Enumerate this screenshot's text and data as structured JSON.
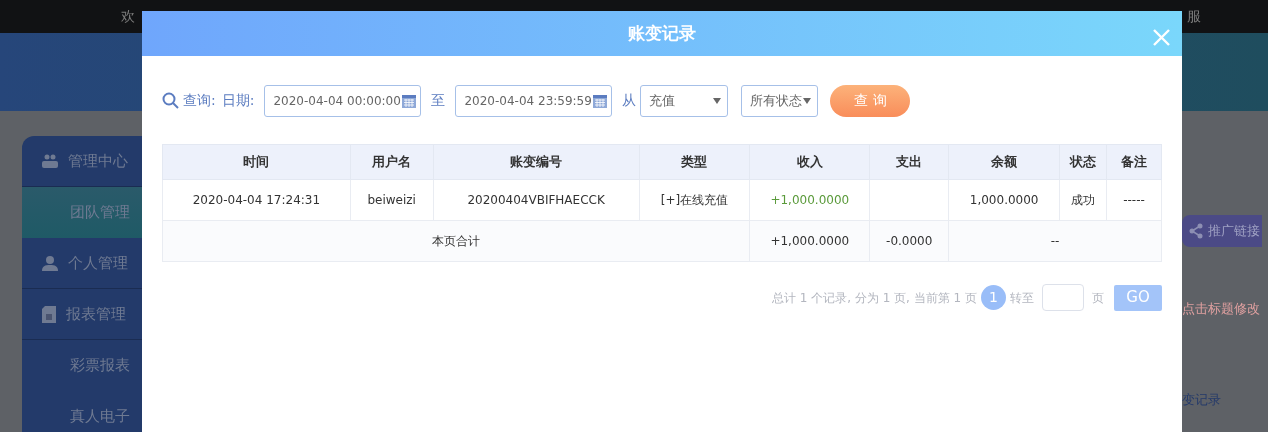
{
  "background": {
    "top_bar": {
      "welcome": "欢",
      "service": "服"
    },
    "sidebar": {
      "items": [
        {
          "label": "管理中心",
          "children": [
            {
              "label": "团队管理",
              "selected": true
            }
          ]
        },
        {
          "label": "个人管理"
        },
        {
          "label": "报表管理",
          "children": [
            {
              "label": "彩票报表",
              "selected": false
            },
            {
              "label": "真人电子",
              "selected": false
            }
          ]
        }
      ]
    },
    "right_panel": {
      "promo_button": "推广链接",
      "hint": "点击标题修改",
      "link": "变记录"
    }
  },
  "modal": {
    "title": "账变记录",
    "filters": {
      "search_label": "查询:",
      "date_label": "日期:",
      "start": "2020-04-04 00:00:00",
      "to_label": "至",
      "end": "2020-04-04 23:59:59",
      "from_label": "从",
      "type": "充值",
      "status": "所有状态",
      "query_button": "查 询"
    },
    "table": {
      "columns": [
        "时间",
        "用户名",
        "账变编号",
        "类型",
        "收入",
        "支出",
        "余额",
        "状态",
        "备注"
      ],
      "rows": [
        {
          "cells": [
            "2020-04-04 17:24:31",
            "beiweizi",
            "20200404VBIFHAECCK",
            "[+]在线充值",
            "+1,000.0000",
            "",
            "1,000.0000",
            "成功",
            "-----"
          ],
          "income_positive": true
        }
      ],
      "total": {
        "label": "本页合计",
        "income": "+1,000.0000",
        "expense": "-0.0000",
        "balance": "--"
      }
    },
    "pagination": {
      "summary": "总计 1 个记录, 分为 1 页, 当前第 1 页",
      "pages": [
        {
          "label": "1",
          "selected": true
        }
      ],
      "goto_label": "转至",
      "page_unit": "页",
      "go_button": "GO"
    }
  }
}
